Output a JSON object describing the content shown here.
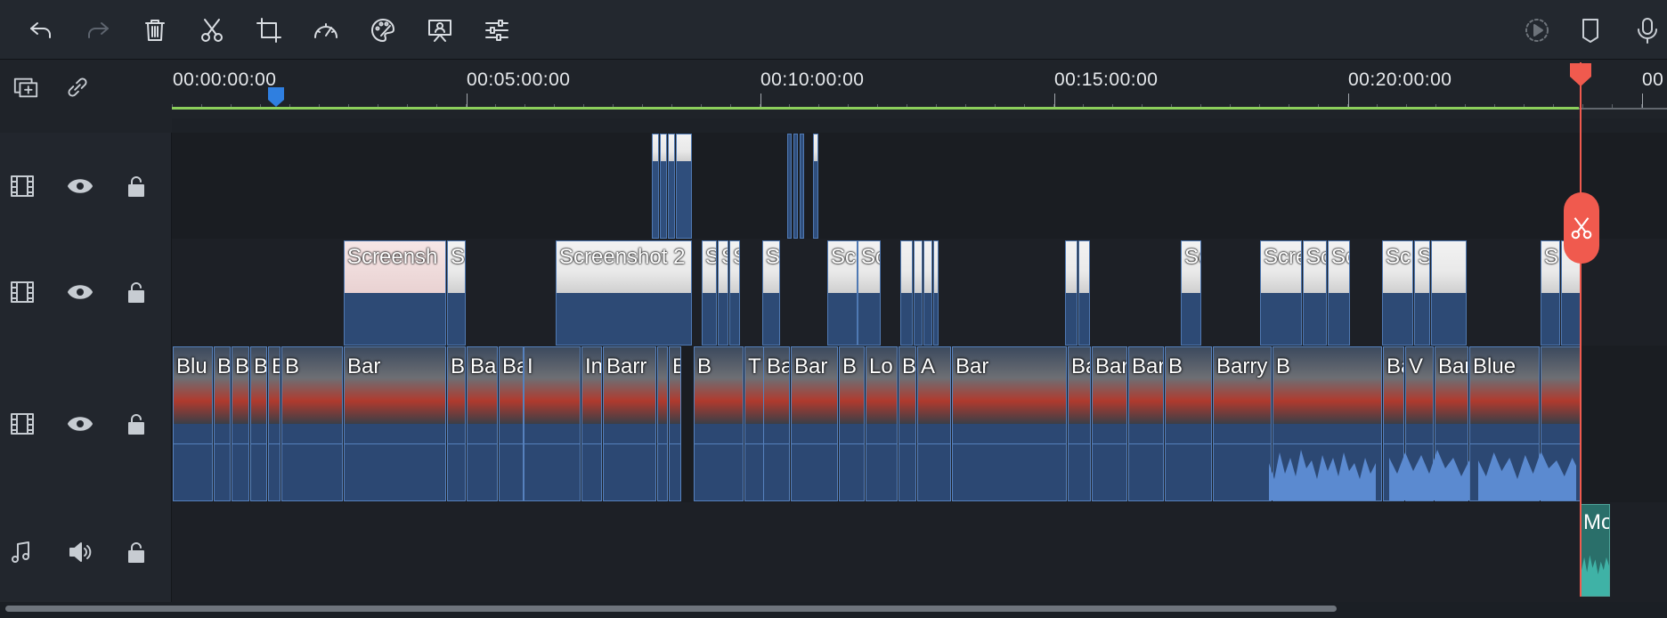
{
  "toolbar": {
    "left_tools": [
      "undo-icon",
      "redo-icon",
      "delete-icon",
      "scissors-icon",
      "crop-icon",
      "speed-icon",
      "color-icon",
      "presentation-icon",
      "adjust-icon"
    ],
    "right_tools": [
      "render-preview-icon",
      "marker-icon",
      "microphone-icon"
    ]
  },
  "timeline": {
    "ruler_labels": [
      "00:00:00:00",
      "00:05:00:00",
      "00:10:00:00",
      "00:15:00:00",
      "00:20:00:00",
      "00"
    ],
    "header_icons": [
      "add-track-icon",
      "link-icon"
    ]
  },
  "tracks": [
    {
      "type": "video",
      "icons": [
        "film-icon",
        "eye-icon",
        "lock-icon"
      ]
    },
    {
      "type": "video",
      "icons": [
        "film-icon",
        "eye-icon",
        "lock-icon"
      ]
    },
    {
      "type": "video",
      "icons": [
        "film-icon",
        "eye-icon",
        "lock-icon"
      ]
    },
    {
      "type": "audio",
      "icons": [
        "music-note-icon",
        "speaker-icon",
        "lock-icon"
      ]
    }
  ],
  "clips": {
    "screenshot_labels": [
      "Screensh",
      "S",
      "Screenshot 2",
      "S",
      "S",
      "S",
      "Sc",
      "Sc",
      "Sc",
      "Sc",
      "Scre",
      "Sc",
      "Sc",
      "Sc",
      "S",
      "S"
    ],
    "video_labels": [
      "Blu",
      "B",
      "B",
      "Barry",
      "Barry Ha",
      "B",
      "Bar",
      "B",
      "Ba",
      "Barry H",
      "I",
      "In",
      "Barr",
      "B",
      "B",
      "T",
      "Barr",
      "Bar",
      "B",
      "Lo",
      "Barry Ha",
      "A",
      "Bar",
      "Ba",
      "Bar",
      "Bar",
      "B",
      "Barry Ha",
      "B",
      "Bai",
      "V",
      "Barry",
      "Blue"
    ],
    "audio_label": "Mo"
  },
  "colors": {
    "accent_clip": "#2d4a75",
    "playhead": "#f05a4e",
    "ruler_progress": "#8ccf5b",
    "audio_clip": "#2a6f6a"
  }
}
